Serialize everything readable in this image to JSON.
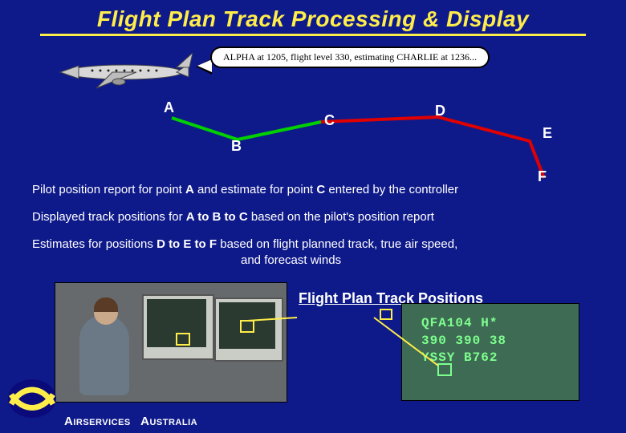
{
  "title": "Flight Plan Track Processing & Display",
  "speech": "ALPHA at 1205, flight level 330, estimating CHARLIE at 1236...",
  "points": {
    "A": "A",
    "B": "B",
    "C": "C",
    "D": "D",
    "E": "E",
    "F": "F"
  },
  "line1_a": "Pilot position report for point ",
  "line1_b": " and estimate for point ",
  "line1_c": "  entered by the controller",
  "line2_a": "Displayed track positions for  ",
  "line2_b": " based on the pilot's position report",
  "seg_abc": "A to B to C",
  "line3_a": "Estimates for positions  ",
  "seg_def": "D to E to F",
  "line3_b": " based on flight planned track, true air speed,",
  "line3_c": "and forecast winds",
  "subtitle": "Flight Plan Track Positions",
  "radar": {
    "callsign": "QFA104 H*",
    "levels": "390 390 38",
    "dest_type": "YSSY  B762"
  },
  "footer_org": "AIRSERVICES",
  "footer_country": "AUSTRALIA"
}
